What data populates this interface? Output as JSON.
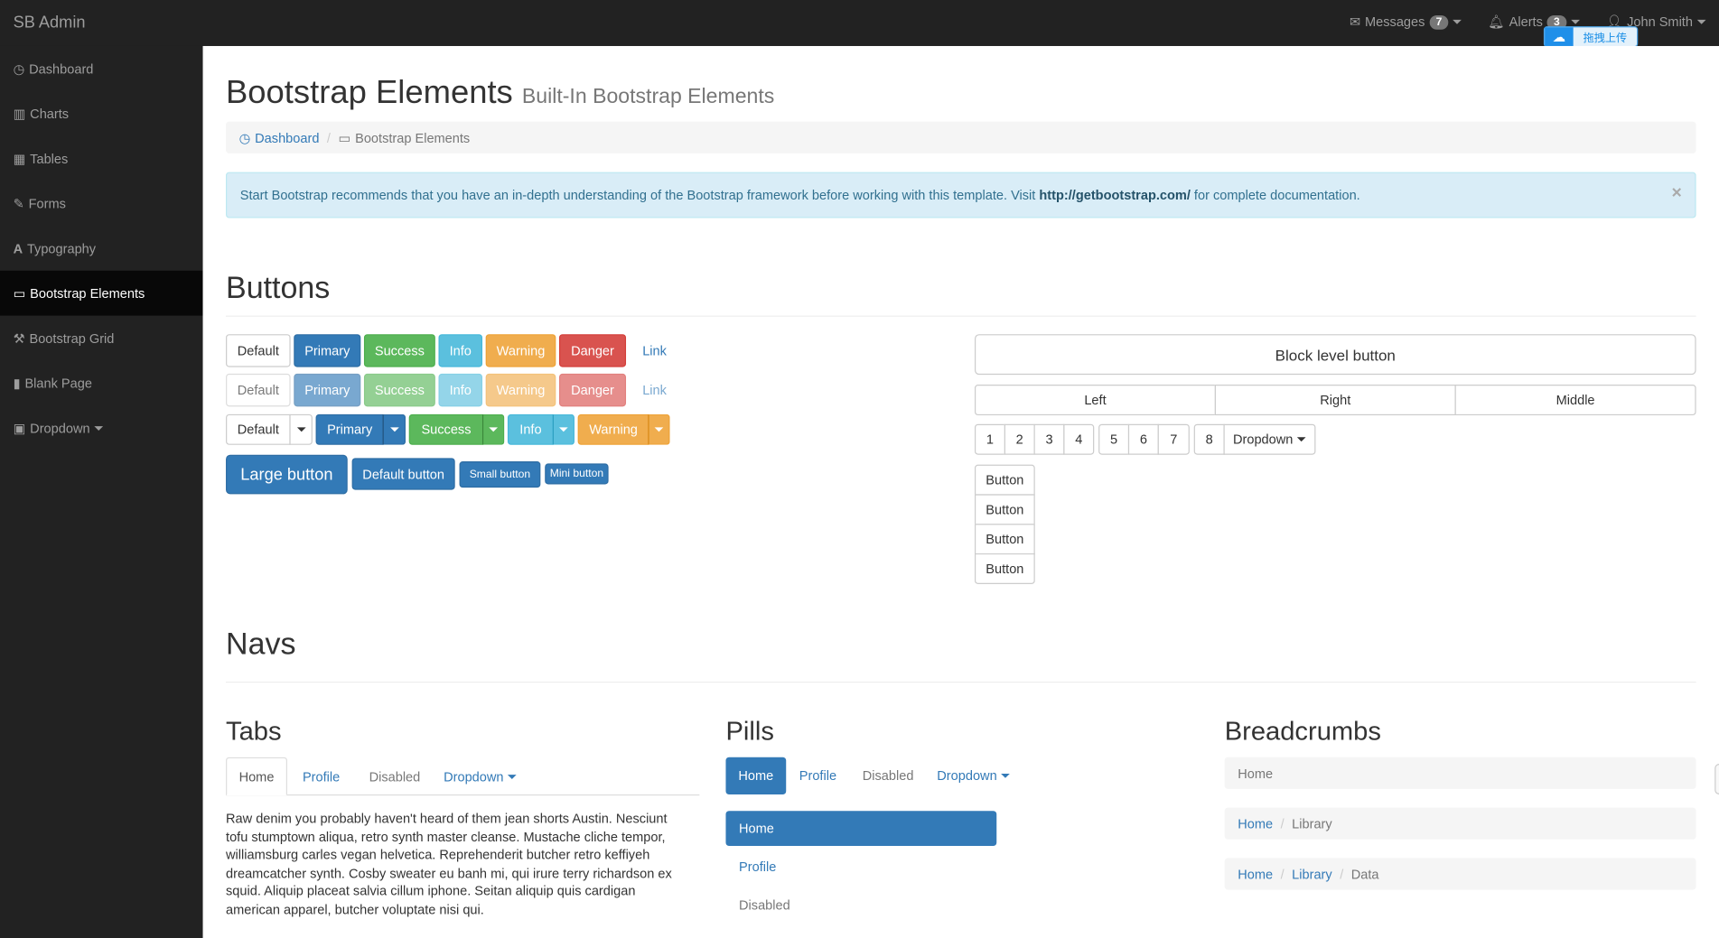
{
  "app": {
    "brand": "SB Admin"
  },
  "topbar": {
    "messages_label": "Messages",
    "messages_count": "7",
    "alerts_label": "Alerts",
    "alerts_count": "3",
    "user_label": "John Smith"
  },
  "upload_widget": {
    "label": "拖拽上传",
    "icon": "cloud-upload-icon"
  },
  "sidebar": {
    "items": [
      {
        "label": "Dashboard",
        "icon": "dashboard-icon"
      },
      {
        "label": "Charts",
        "icon": "bar-chart-icon"
      },
      {
        "label": "Tables",
        "icon": "table-icon"
      },
      {
        "label": "Forms",
        "icon": "edit-icon"
      },
      {
        "label": "Typography",
        "icon": "font-icon"
      },
      {
        "label": "Bootstrap Elements",
        "icon": "desktop-icon"
      },
      {
        "label": "Bootstrap Grid",
        "icon": "wrench-icon"
      },
      {
        "label": "Blank Page",
        "icon": "file-icon"
      },
      {
        "label": "Dropdown",
        "icon": "caret-square-icon"
      }
    ]
  },
  "header": {
    "title": "Bootstrap Elements",
    "subtitle": "Built-In Bootstrap Elements"
  },
  "breadcrumb": {
    "home": "Dashboard",
    "current": "Bootstrap Elements"
  },
  "alert": {
    "text_before": "Start Bootstrap recommends that you have an in-depth understanding of the Bootstrap framework before working with this template. Visit ",
    "link": "http://getbootstrap.com/",
    "text_after": " for complete documentation.",
    "close": "×"
  },
  "buttons_section": {
    "title": "Buttons",
    "row1": [
      "Default",
      "Primary",
      "Success",
      "Info",
      "Warning",
      "Danger",
      "Link"
    ],
    "row2": [
      "Default",
      "Primary",
      "Success",
      "Info",
      "Warning",
      "Danger",
      "Link"
    ],
    "row3": [
      "Default",
      "Primary",
      "Success",
      "Info",
      "Warning"
    ],
    "sizes": [
      "Large button",
      "Default button",
      "Small button",
      "Mini button"
    ],
    "block": "Block level button",
    "justified": [
      "Left",
      "Right",
      "Middle"
    ],
    "toolbar": [
      "1",
      "2",
      "3",
      "4",
      "5",
      "6",
      "7",
      "8",
      "Dropdown"
    ],
    "vertical": [
      "Button",
      "Button",
      "Button",
      "Button"
    ]
  },
  "navs_section": {
    "title": "Navs",
    "tabs_title": "Tabs",
    "tabs": [
      "Home",
      "Profile",
      "Disabled",
      "Dropdown"
    ],
    "tab_content": "Raw denim you probably haven't heard of them jean shorts Austin. Nesciunt tofu stumptown aliqua, retro synth master cleanse. Mustache cliche tempor, williamsburg carles vegan helvetica. Reprehenderit butcher retro keffiyeh dreamcatcher synth. Cosby sweater eu banh mi, qui irure terry richardson ex squid. Aliquip placeat salvia cillum iphone. Seitan aliquip quis cardigan american apparel, butcher voluptate nisi qui.",
    "pills_title": "Pills",
    "pills": [
      "Home",
      "Profile",
      "Disabled",
      "Dropdown"
    ],
    "vpills": [
      "Home",
      "Profile",
      "Disabled"
    ],
    "breadcrumbs_title": "Breadcrumbs",
    "crumbs1": [
      "Home"
    ],
    "crumbs2": [
      "Home",
      "Library"
    ],
    "crumbs3": [
      "Home",
      "Library",
      "Data"
    ]
  }
}
